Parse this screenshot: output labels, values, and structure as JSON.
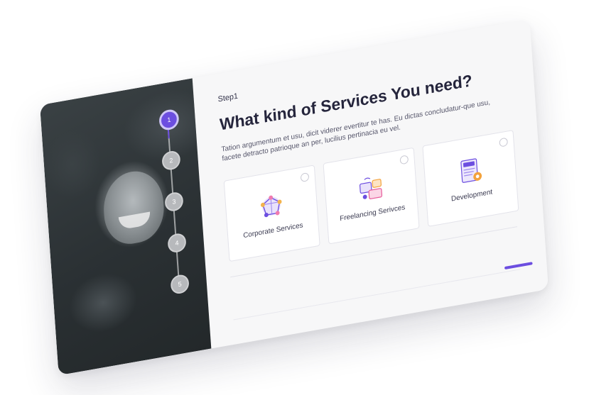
{
  "wizard": {
    "step_label": "Step1",
    "title": "What kind of Services You need?",
    "description": "Tation argumentum et usu, dicit viderer evertitur te has. Eu dictas concludatur-que usu, facete detracto patrioque an per, lucilius pertinacia eu vel.",
    "steps": [
      {
        "label": "1",
        "active": true
      },
      {
        "label": "2",
        "active": false
      },
      {
        "label": "3",
        "active": false
      },
      {
        "label": "4",
        "active": false
      },
      {
        "label": "5",
        "active": false
      }
    ],
    "options": [
      {
        "label": "Corporate Services",
        "icon": "network-icon"
      },
      {
        "label": "Freelancing Serivces",
        "icon": "freelance-icon"
      },
      {
        "label": "Development",
        "icon": "api-document-icon"
      }
    ]
  },
  "colors": {
    "accent": "#6c4ee0",
    "panel_dark": "#2b3134",
    "card_bg": "#f7f7f8",
    "title": "#25253c"
  }
}
